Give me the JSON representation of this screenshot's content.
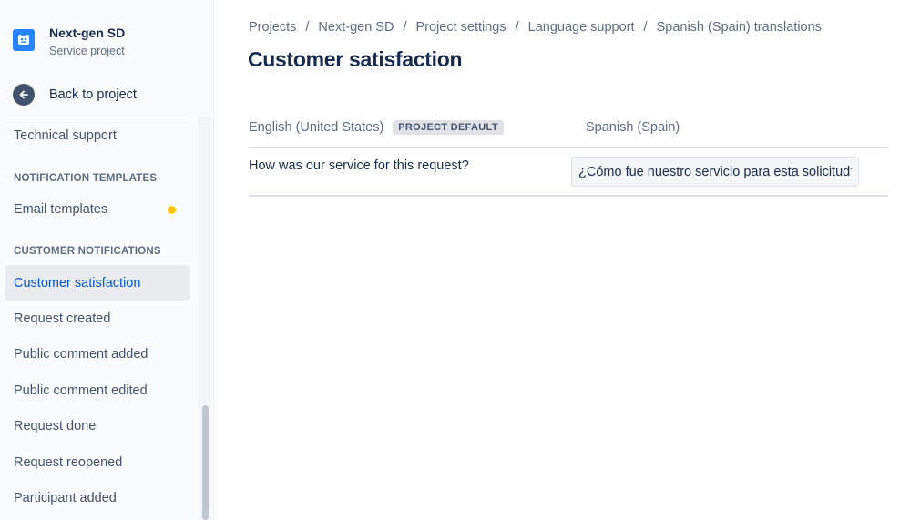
{
  "project": {
    "name": "Next-gen SD",
    "type": "Service project",
    "avatar_color": "#2684ff"
  },
  "sidebar": {
    "back_label": "Back to project",
    "back_icon": "arrow-left-icon",
    "items": [
      {
        "label": "Technical support"
      },
      {
        "heading": "NOTIFICATION TEMPLATES"
      },
      {
        "label": "Email templates",
        "badge": "yellow-dot"
      },
      {
        "heading": "CUSTOMER NOTIFICATIONS"
      },
      {
        "label": "Customer satisfaction",
        "active": true
      },
      {
        "label": "Request created"
      },
      {
        "label": "Public comment added"
      },
      {
        "label": "Public comment edited"
      },
      {
        "label": "Request done"
      },
      {
        "label": "Request reopened"
      },
      {
        "label": "Participant added"
      }
    ]
  },
  "breadcrumb": [
    "Projects",
    "Next-gen SD",
    "Project settings",
    "Language support",
    "Spanish (Spain) translations"
  ],
  "page_title": "Customer satisfaction",
  "table": {
    "source_language": "English (United States)",
    "default_badge": "PROJECT DEFAULT",
    "target_language": "Spanish (Spain)",
    "rows": [
      {
        "source": "How was our service for this request?",
        "translation": "¿Cómo fue nuestro servicio para esta solicitud?"
      }
    ]
  },
  "colors": {
    "accent": "#0052cc",
    "text": "#172b4d",
    "subtle": "#5e6c84",
    "badge_dot": "#ffc400"
  }
}
